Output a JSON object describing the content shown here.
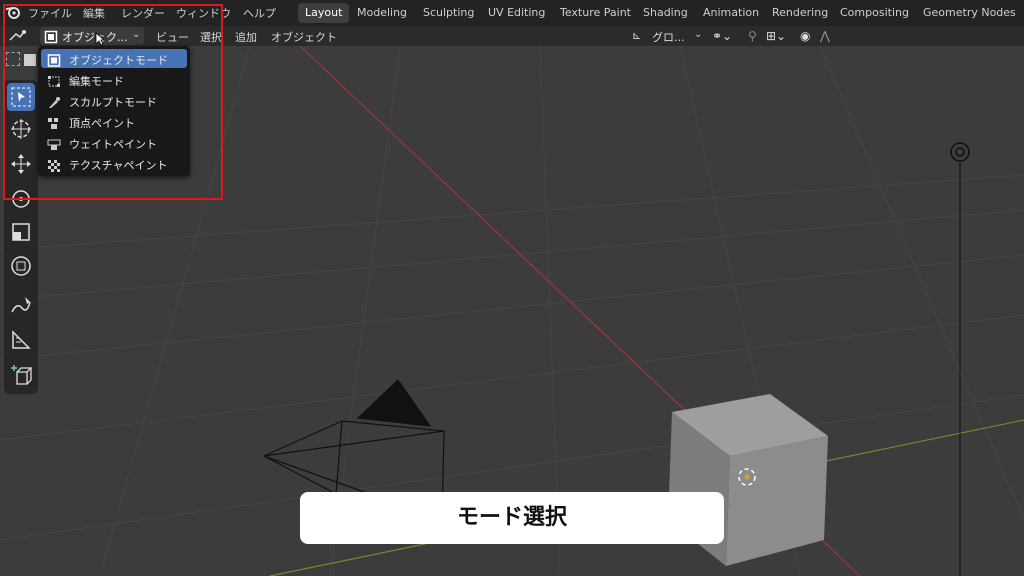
{
  "menubar": {
    "items": [
      "ファイル",
      "編集",
      "レンダー",
      "ウィンドウ",
      "ヘルプ"
    ]
  },
  "workspaces": {
    "tabs": [
      "Layout",
      "Modeling",
      "Sculpting",
      "UV Editing",
      "Texture Paint",
      "Shading",
      "Animation",
      "Rendering",
      "Compositing",
      "Geometry Nodes"
    ],
    "active": "Layout"
  },
  "header": {
    "mode_label": "オブジェク...",
    "menus": [
      "ビュー",
      "選択",
      "追加",
      "オブジェクト"
    ],
    "orientation_label": "グロ..."
  },
  "mode_menu": {
    "items": [
      {
        "label": "オブジェクトモード",
        "icon": "object-mode-icon",
        "active": true
      },
      {
        "label": "編集モード",
        "icon": "edit-mode-icon",
        "active": false
      },
      {
        "label": "スカルプトモード",
        "icon": "sculpt-mode-icon",
        "active": false
      },
      {
        "label": "頂点ペイント",
        "icon": "vertex-paint-icon",
        "active": false
      },
      {
        "label": "ウェイトペイント",
        "icon": "weight-paint-icon",
        "active": false
      },
      {
        "label": "テクスチャペイント",
        "icon": "texture-paint-icon",
        "active": false
      }
    ]
  },
  "toolbar": {
    "tools": [
      "select-box-icon",
      "cursor-icon",
      "move-icon",
      "rotate-icon",
      "scale-icon",
      "transform-icon",
      "annotate-icon",
      "measure-icon",
      "add-cube-icon"
    ],
    "active": "select-box-icon"
  },
  "caption": {
    "text": "モード選択"
  },
  "colors": {
    "accent": "#4772b3",
    "highlight_box": "#e0171c",
    "x_axis": "#a0343b",
    "y_axis": "#6e8f2d"
  }
}
